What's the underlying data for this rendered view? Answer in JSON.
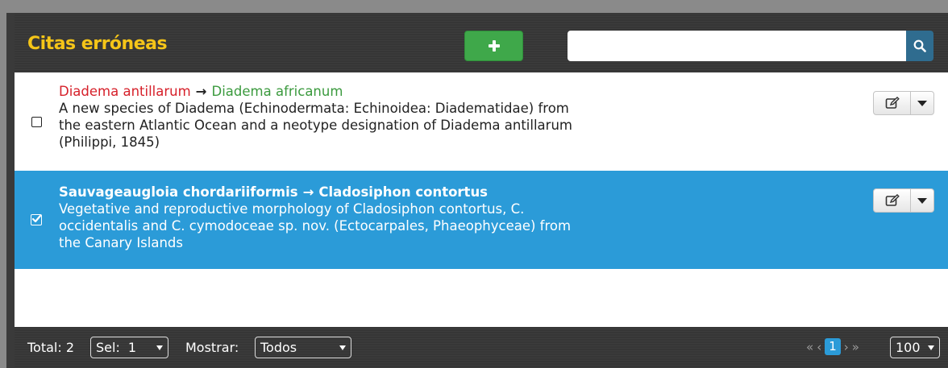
{
  "header": {
    "title": "Citas erróneas",
    "search": {
      "value": "",
      "placeholder": ""
    }
  },
  "rows": [
    {
      "checked": false,
      "old_name": "Diadema antillarum",
      "arrow": "→",
      "new_name": "Diadema africanum",
      "reference": "A new species of Diadema (Echinodermata: Echinoidea: Diadematidae) from the eastern Atlantic Ocean and a neotype designation of Diadema antillarum (Philippi, 1845)"
    },
    {
      "checked": true,
      "old_name": "Sauvageaugloia chordariiformis",
      "arrow": "→",
      "new_name": "Cladosiphon contortus",
      "reference": "Vegetative and reproductive morphology of Cladosiphon contortus, C. occidentalis and C. cymodoceae sp. nov. (Ectocarpales, Phaeophyceae) from the Canary Islands"
    }
  ],
  "footer": {
    "total_label": "Total: 2",
    "sel_label": "Sel:",
    "sel_value": "1",
    "mostrar_label": "Mostrar:",
    "mostrar_value": "Todos",
    "first_page": "«",
    "prev_page": "‹",
    "current_page": "1",
    "next_page": "›",
    "last_page": "»",
    "per_page_value": "100"
  },
  "colors": {
    "header_bg": "#363636",
    "title": "#f5c518",
    "add_button": "#3fa84a",
    "search_button": "#2f6c8f",
    "selected_row": "#2b9bd8",
    "old_name": "#d6202a",
    "new_name": "#3b9a3e"
  },
  "icons": {
    "add": "plus-icon",
    "search": "search-icon",
    "edit": "edit-icon",
    "dropdown": "caret-down-icon",
    "checkbox": "checkbox-icon"
  }
}
